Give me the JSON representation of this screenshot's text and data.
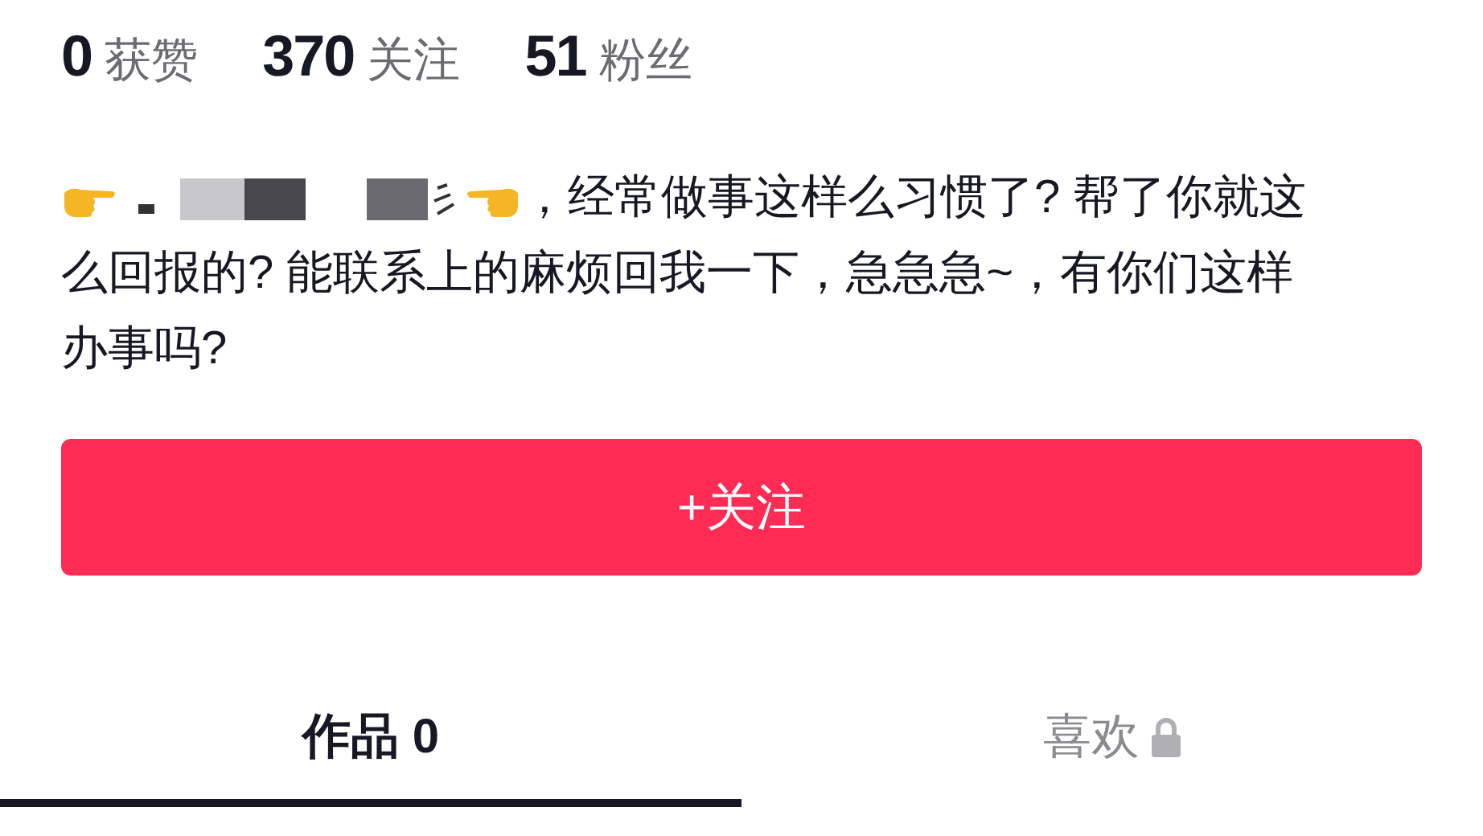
{
  "stats": [
    {
      "text": "**0** 获赞"
    },
    {
      "text": "**370** 关注"
    },
    {
      "text": "**51** 粉丝"
    }
  ],
  "bio": {
    "lines": [
      "，经常做事这样么习惯了? 帮了你就这",
      "么回报的? 能联系上的麻烦回我一下，急急急~，有你们这样",
      "办事吗?"
    ]
  },
  "follow_button": {
    "label": "+关注"
  },
  "tabs": [
    {
      "label": "作品 0",
      "selected": true,
      "locked": false
    },
    {
      "label": "喜欢",
      "selected": false,
      "locked": true
    }
  ]
}
